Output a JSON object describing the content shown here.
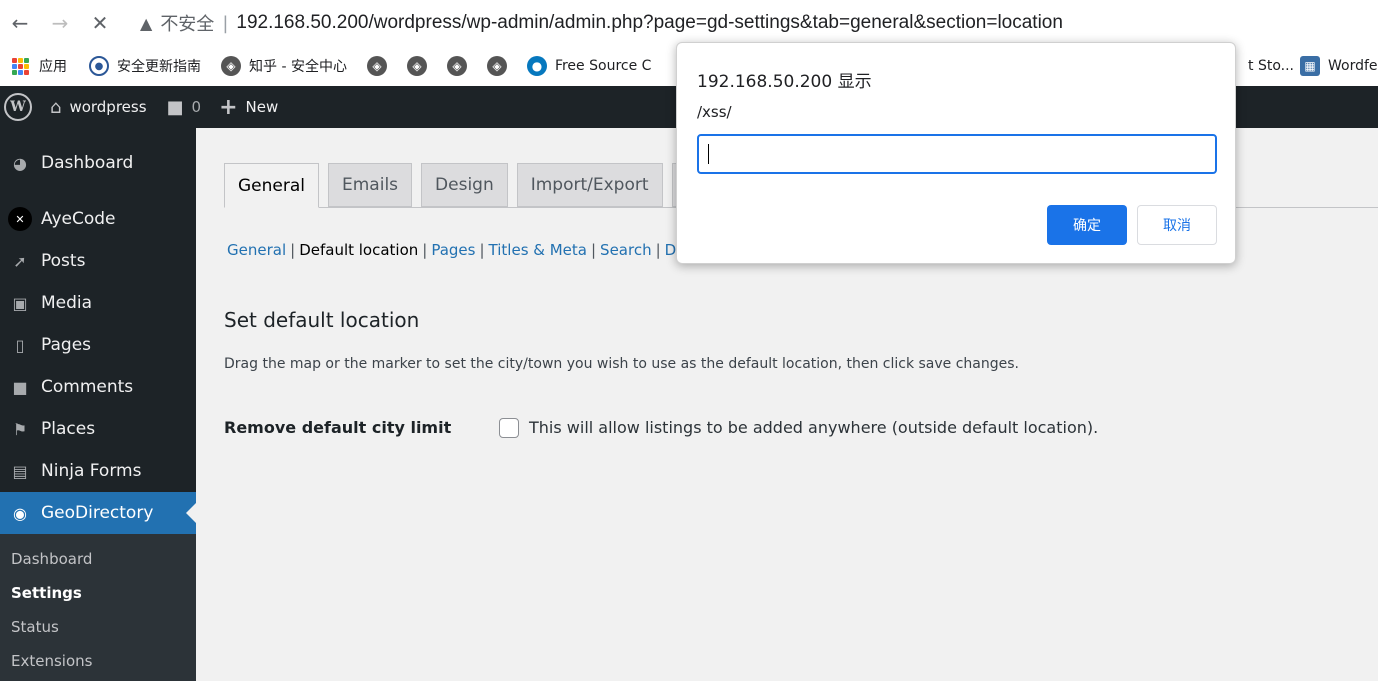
{
  "browser": {
    "security_label": "不安全",
    "url": "192.168.50.200/wordpress/wp-admin/admin.php?page=gd-settings&tab=general&section=location",
    "bookmarks": [
      {
        "label": "应用",
        "icon": "apps-grid-icon"
      },
      {
        "label": "安全更新指南",
        "icon": "shield-icon"
      },
      {
        "label": "知乎 - 安全中心",
        "icon": "globe-icon"
      },
      {
        "label": "",
        "icon": "globe-icon"
      },
      {
        "label": "",
        "icon": "globe-icon"
      },
      {
        "label": "",
        "icon": "globe-icon"
      },
      {
        "label": "",
        "icon": "globe-icon"
      },
      {
        "label": "Free Source C",
        "icon": "drupal-icon"
      },
      {
        "label": "t Sto...",
        "icon": ""
      },
      {
        "label": "Wordfe",
        "icon": "building-icon"
      }
    ]
  },
  "adminbar": {
    "site_name": "wordpress",
    "comments_count": "0",
    "new_label": "New"
  },
  "sidebar": {
    "items": [
      {
        "label": "Dashboard",
        "icon": "dashboard-icon"
      },
      {
        "label": "AyeCode",
        "icon": "ayecode-icon"
      },
      {
        "label": "Posts",
        "icon": "pin-icon"
      },
      {
        "label": "Media",
        "icon": "media-icon"
      },
      {
        "label": "Pages",
        "icon": "pages-icon"
      },
      {
        "label": "Comments",
        "icon": "comment-icon"
      },
      {
        "label": "Places",
        "icon": "map-icon"
      },
      {
        "label": "Ninja Forms",
        "icon": "forms-icon"
      },
      {
        "label": "GeoDirectory",
        "icon": "globe-icon"
      }
    ],
    "submenu": [
      "Dashboard",
      "Settings",
      "Status",
      "Extensions"
    ]
  },
  "tabs": [
    "General",
    "Emails",
    "Design",
    "Import/Export",
    "A"
  ],
  "subnav": [
    "General",
    "Default location",
    "Pages",
    "Titles & Meta",
    "Search",
    "Du"
  ],
  "main": {
    "section_title": "Set default location",
    "description": "Drag the map or the marker to set the city/town you wish to use as the default location, then click save changes.",
    "field_label": "Remove default city limit",
    "checkbox_label": "This will allow listings to be added anywhere (outside default location).",
    "checkbox_checked": false
  },
  "dialog": {
    "title": "192.168.50.200 显示",
    "message": "/xss/",
    "input_value": "",
    "ok_label": "确定",
    "cancel_label": "取消"
  },
  "colors": {
    "wp_dark": "#1d2327",
    "wp_blue": "#2271b1",
    "dialog_blue": "#1a73e8"
  }
}
